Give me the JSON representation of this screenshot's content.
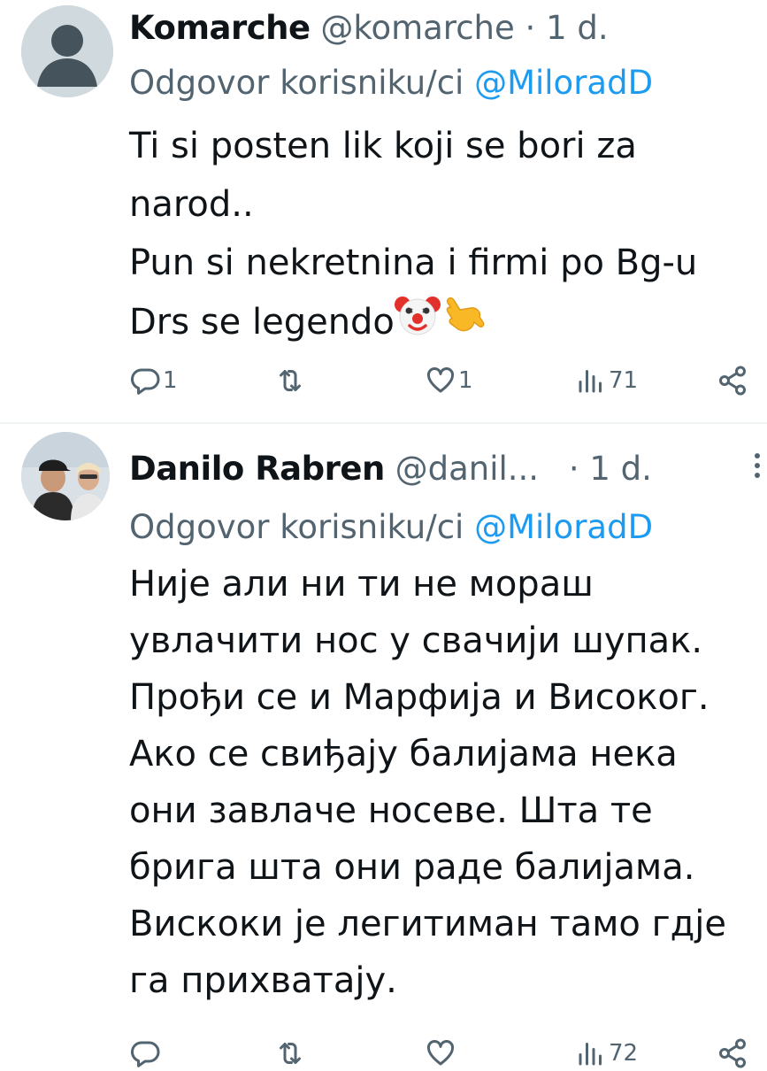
{
  "tweets": [
    {
      "name": "Komarche",
      "handle": "@komarche",
      "separator": "·",
      "time": "1 d.",
      "reply_prefix": "Odgovor korisniku/ci",
      "reply_mention": "@MiloradD",
      "lines": [
        "Ti si posten lik koji se bori za",
        "narod..",
        "Pun si nekretnina i firmi po Bg-u",
        "Drs se legendo"
      ],
      "emojis": [
        "clown-face",
        "call-me-hand"
      ],
      "stats": {
        "replies": "1",
        "retweets": "",
        "likes": "1",
        "views": "71"
      }
    },
    {
      "name": "Danilo Rabren",
      "handle": "@danil...",
      "separator": "·",
      "time": "1 d.",
      "reply_prefix": "Odgovor korisniku/ci",
      "reply_mention": "@MiloradD",
      "lines": [
        "Није али ни ти не мораш",
        "увлачити нос у свачији шупак.",
        "Прођи се и Марфија и Високог.",
        "Ако се свиђају балијама нека",
        "они завлаче носеве. Шта те",
        "брига шта они раде балијама.",
        "Вискоки је легитиман тамо гдје",
        "га прихватају."
      ],
      "stats": {
        "replies": "",
        "retweets": "",
        "likes": "",
        "views": "72"
      }
    }
  ],
  "colors": {
    "text": "#0f1419",
    "secondary": "#536471",
    "accent": "#1d9bf0",
    "divider": "#eff3f4"
  }
}
